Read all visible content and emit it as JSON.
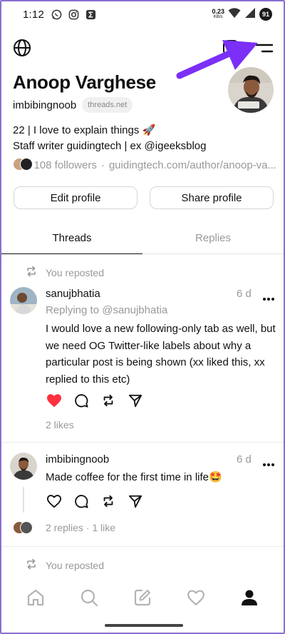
{
  "status": {
    "time": "1:12",
    "speed": "0.23",
    "speed_unit": "KB/s",
    "battery": "91"
  },
  "profile": {
    "name": "Anoop Varghese",
    "handle": "imbibingnoob",
    "domain_badge": "threads.net",
    "bio_line1": "22 | I love to explain things 🚀",
    "bio_line2": "Staff writer guidingtech | ex @igeeksblog",
    "followers": "108 followers",
    "separator": "·",
    "link": "guidingtech.com/author/anoop-va..."
  },
  "buttons": {
    "edit": "Edit profile",
    "share": "Share profile"
  },
  "tabs": [
    {
      "label": "Threads",
      "active": true
    },
    {
      "label": "Replies",
      "active": false
    }
  ],
  "feed": [
    {
      "repost_label": "You reposted",
      "author": "sanujbhatia",
      "time": "6 d",
      "reply_to": "Replying to @sanujbhatia",
      "text": "I would love a new following-only tab as well, but we need OG Twitter-like labels about why a particular post is being shown (xx liked this, xx replied to this etc)",
      "liked": true,
      "meta": "2 likes"
    },
    {
      "author": "imbibingnoob",
      "time": "6 d",
      "text": "Made coffee for the first time in life🤩",
      "liked": false,
      "meta": "2 replies · 1 like"
    },
    {
      "repost_label": "You reposted"
    }
  ],
  "icons": {
    "status": [
      "whatsapp-icon",
      "instagram-icon",
      "sigma-app-icon",
      "wifi-icon",
      "signal-icon",
      "battery-icon"
    ],
    "top": [
      "globe-icon",
      "instagram-icon",
      "menu-icon"
    ],
    "actions": [
      "heart-icon",
      "comment-icon",
      "repost-icon",
      "share-icon"
    ],
    "nav": [
      "home-icon",
      "search-icon",
      "compose-icon",
      "activity-heart-icon",
      "profile-icon"
    ]
  },
  "colors": {
    "accent_arrow": "#7b2ff7",
    "like_red": "#ff3040",
    "muted": "#999999"
  }
}
